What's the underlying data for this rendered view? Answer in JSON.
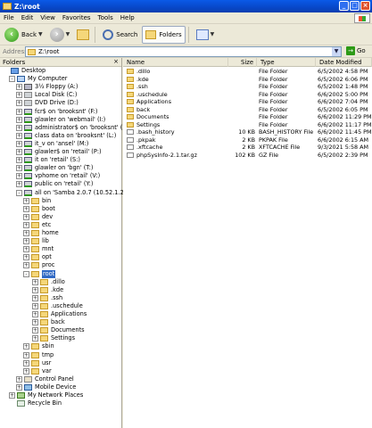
{
  "window": {
    "title": "Z:\\root"
  },
  "menu": [
    "File",
    "Edit",
    "View",
    "Favorites",
    "Tools",
    "Help"
  ],
  "toolbar": {
    "back": "Back",
    "search": "Search",
    "folders": "Folders"
  },
  "address": {
    "label": "Address",
    "value": "Z:\\root",
    "go": "Go"
  },
  "folders_pane": {
    "title": "Folders",
    "close": "×"
  },
  "tree": [
    {
      "label": "Desktop",
      "icon": "desktop",
      "level": 0,
      "exp": ""
    },
    {
      "label": "My Computer",
      "icon": "computer",
      "level": 1,
      "exp": "-"
    },
    {
      "label": "3½ Floppy (A:)",
      "icon": "floppy",
      "level": 2,
      "exp": "+"
    },
    {
      "label": "Local Disk (C:)",
      "icon": "drive",
      "level": 2,
      "exp": "+"
    },
    {
      "label": "DVD Drive (D:)",
      "icon": "drive",
      "level": 2,
      "exp": "+"
    },
    {
      "label": "fcr$ on 'brooksnt' (F:)",
      "icon": "netdrive",
      "level": 2,
      "exp": "+"
    },
    {
      "label": "glawler on 'webmail' (I:)",
      "icon": "netdrive",
      "level": 2,
      "exp": "+"
    },
    {
      "label": "administrator$ on 'brooksnt' (K:)",
      "icon": "netdrive",
      "level": 2,
      "exp": "+"
    },
    {
      "label": "class data on 'brooksnt' (L:)",
      "icon": "netdrive",
      "level": 2,
      "exp": "+"
    },
    {
      "label": "it_v on 'ansel' (M:)",
      "icon": "netdrive",
      "level": 2,
      "exp": "+"
    },
    {
      "label": "glawler$ on 'retail' (P:)",
      "icon": "netdrive",
      "level": 2,
      "exp": "+"
    },
    {
      "label": "it on 'retail' (S:)",
      "icon": "netdrive",
      "level": 2,
      "exp": "+"
    },
    {
      "label": "glawler on 'bgn' (T:)",
      "icon": "netdrive",
      "level": 2,
      "exp": "+"
    },
    {
      "label": "vphome on 'retail' (V:)",
      "icon": "netdrive",
      "level": 2,
      "exp": "+"
    },
    {
      "label": "public on 'retail' (Y:)",
      "icon": "netdrive",
      "level": 2,
      "exp": "+"
    },
    {
      "label": "all on 'Samba 2.0.7 (10.52.1.215)' (Z:)",
      "icon": "netdrive",
      "level": 2,
      "exp": "-"
    },
    {
      "label": "bin",
      "icon": "folder",
      "level": 3,
      "exp": "+"
    },
    {
      "label": "boot",
      "icon": "folder",
      "level": 3,
      "exp": "+"
    },
    {
      "label": "dev",
      "icon": "folder",
      "level": 3,
      "exp": "+"
    },
    {
      "label": "etc",
      "icon": "folder",
      "level": 3,
      "exp": "+"
    },
    {
      "label": "home",
      "icon": "folder",
      "level": 3,
      "exp": "+"
    },
    {
      "label": "lib",
      "icon": "folder",
      "level": 3,
      "exp": "+"
    },
    {
      "label": "mnt",
      "icon": "folder",
      "level": 3,
      "exp": "+"
    },
    {
      "label": "opt",
      "icon": "folder",
      "level": 3,
      "exp": "+"
    },
    {
      "label": "proc",
      "icon": "folder",
      "level": 3,
      "exp": "+"
    },
    {
      "label": "root",
      "icon": "folder",
      "level": 3,
      "exp": "-",
      "selected": true
    },
    {
      "label": ".dillo",
      "icon": "folder",
      "level": 4,
      "exp": "+"
    },
    {
      "label": ".kde",
      "icon": "folder",
      "level": 4,
      "exp": "+"
    },
    {
      "label": ".ssh",
      "icon": "folder",
      "level": 4,
      "exp": "+"
    },
    {
      "label": ".uschedule",
      "icon": "folder",
      "level": 4,
      "exp": "+"
    },
    {
      "label": "Applications",
      "icon": "folder",
      "level": 4,
      "exp": "+"
    },
    {
      "label": "back",
      "icon": "folder",
      "level": 4,
      "exp": "+"
    },
    {
      "label": "Documents",
      "icon": "folder",
      "level": 4,
      "exp": "+"
    },
    {
      "label": "Settings",
      "icon": "folder",
      "level": 4,
      "exp": "+"
    },
    {
      "label": "sbin",
      "icon": "folder",
      "level": 3,
      "exp": "+"
    },
    {
      "label": "tmp",
      "icon": "folder",
      "level": 3,
      "exp": "+"
    },
    {
      "label": "usr",
      "icon": "folder",
      "level": 3,
      "exp": "+"
    },
    {
      "label": "var",
      "icon": "folder",
      "level": 3,
      "exp": "+"
    },
    {
      "label": "Control Panel",
      "icon": "cpanel",
      "level": 2,
      "exp": "+"
    },
    {
      "label": "Mobile Device",
      "icon": "mobile",
      "level": 2,
      "exp": "+"
    },
    {
      "label": "My Network Places",
      "icon": "net",
      "level": 1,
      "exp": "+"
    },
    {
      "label": "Recycle Bin",
      "icon": "recycle",
      "level": 1,
      "exp": ""
    }
  ],
  "columns": {
    "name": "Name",
    "size": "Size",
    "type": "Type",
    "date": "Date Modified"
  },
  "files": [
    {
      "name": ".dillo",
      "size": "",
      "type": "File Folder",
      "date": "6/5/2002 4:58 PM",
      "icon": "folder"
    },
    {
      "name": ".kde",
      "size": "",
      "type": "File Folder",
      "date": "6/5/2002 6:06 PM",
      "icon": "folder"
    },
    {
      "name": ".ssh",
      "size": "",
      "type": "File Folder",
      "date": "6/5/2002 1:48 PM",
      "icon": "folder"
    },
    {
      "name": ".uschedule",
      "size": "",
      "type": "File Folder",
      "date": "6/6/2002 5:00 PM",
      "icon": "folder"
    },
    {
      "name": "Applications",
      "size": "",
      "type": "File Folder",
      "date": "6/6/2002 7:04 PM",
      "icon": "folder"
    },
    {
      "name": "back",
      "size": "",
      "type": "File Folder",
      "date": "6/5/2002 6:05 PM",
      "icon": "folder"
    },
    {
      "name": "Documents",
      "size": "",
      "type": "File Folder",
      "date": "6/6/2002 11:29 PM",
      "icon": "folder"
    },
    {
      "name": "Settings",
      "size": "",
      "type": "File Folder",
      "date": "6/6/2002 11:17 PM",
      "icon": "folder"
    },
    {
      "name": ".bash_history",
      "size": "10 KB",
      "type": "BASH_HISTORY File",
      "date": "6/6/2002 11:45 PM",
      "icon": "file"
    },
    {
      "name": ".pkpak",
      "size": "2 KB",
      "type": "PKPAK File",
      "date": "6/6/2002 6:15 AM",
      "icon": "file"
    },
    {
      "name": ".xftcache",
      "size": "2 KB",
      "type": "XFTCACHE File",
      "date": "9/3/2021 5:58 AM",
      "icon": "file"
    },
    {
      "name": "phpSysInfo-2.1.tar.gz",
      "size": "102 KB",
      "type": "GZ File",
      "date": "6/5/2002 2:39 PM",
      "icon": "file"
    }
  ]
}
